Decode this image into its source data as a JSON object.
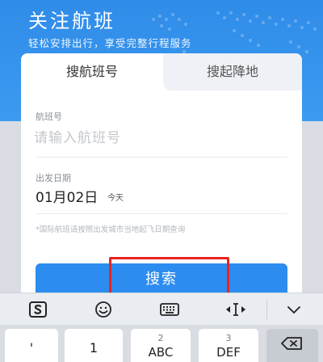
{
  "header": {
    "title": "关注航班",
    "subtitle": "轻松安排出行，享受完整行程服务"
  },
  "tabs": [
    {
      "label": "搜航班号",
      "active": true
    },
    {
      "label": "搜起降地",
      "active": false
    }
  ],
  "form": {
    "flight_label": "航班号",
    "flight_placeholder": "请输入航班号",
    "date_label": "出发日期",
    "date_value": "01月02日",
    "date_suffix": "今天",
    "note": "*国际航班请按照出发城市当地起飞日期查询"
  },
  "search_button": {
    "label": "搜索"
  },
  "colors": {
    "primary": "#2d8cf0",
    "hero": "#3d9af0",
    "highlight": "#e8231f"
  },
  "ime_toolbar": {
    "icons": [
      "sogou-icon",
      "emoji-icon",
      "keyboard-icon",
      "cursor-move-icon",
      "collapse-icon"
    ]
  },
  "keyboard": {
    "keys": [
      {
        "num": "",
        "main": "'"
      },
      {
        "num": "",
        "main": "1"
      },
      {
        "num": "2",
        "main": "ABC"
      },
      {
        "num": "3",
        "main": "DEF"
      }
    ]
  }
}
